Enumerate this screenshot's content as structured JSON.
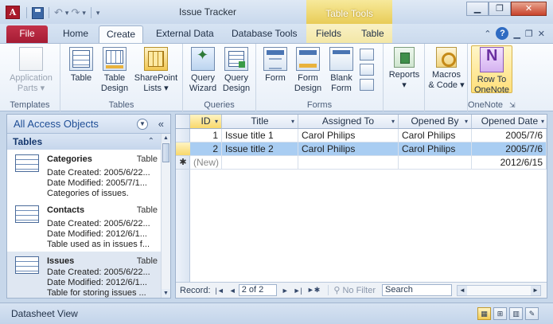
{
  "app": {
    "icon_letter": "A",
    "window_title": "Issue Tracker",
    "context_header": "Table Tools"
  },
  "qat": {
    "undo": "↶",
    "redo": "↷",
    "customize": "▾"
  },
  "window_controls": {
    "minimize": "▁",
    "restore": "❐",
    "close": "✕"
  },
  "tabs": {
    "file": "File",
    "home": "Home",
    "create": "Create",
    "external": "External Data",
    "dbtools": "Database Tools",
    "fields": "Fields",
    "table": "Table"
  },
  "ribbon_right": {
    "minimize": "⌃",
    "help": "?"
  },
  "ribbon": {
    "templates": {
      "label": "Templates",
      "app_parts_1": "Application",
      "app_parts_2": "Parts ▾"
    },
    "tables": {
      "label": "Tables",
      "table": "Table",
      "tdesign_1": "Table",
      "tdesign_2": "Design",
      "sp_1": "SharePoint",
      "sp_2": "Lists ▾"
    },
    "queries": {
      "label": "Queries",
      "wiz_1": "Query",
      "wiz_2": "Wizard",
      "qd_1": "Query",
      "qd_2": "Design"
    },
    "forms": {
      "label": "Forms",
      "form": "Form",
      "fdesign_1": "Form",
      "fdesign_2": "Design",
      "blank_1": "Blank",
      "blank_2": "Form"
    },
    "reports": {
      "label_1": "Reports",
      "label_2": "▾"
    },
    "macros": {
      "label_1": "Macros",
      "label_2": "& Code ▾"
    },
    "onenote": {
      "label": "OneNote",
      "btn_1": "Row To",
      "btn_2": "OneNote",
      "launcher": "⇲"
    }
  },
  "navpane": {
    "title": "All Access Objects",
    "picker": "▼",
    "collapse": "«",
    "category": "Tables",
    "category_chevron": "⌃",
    "items": [
      {
        "name": "Categories",
        "type": "Table",
        "created": "Date Created: 2005/6/22...",
        "modified": "Date Modified: 2005/7/1...",
        "desc": "Categories of issues."
      },
      {
        "name": "Contacts",
        "type": "Table",
        "created": "Date Created: 2005/6/22...",
        "modified": "Date Modified: 2012/6/1...",
        "desc": "Table used as in issues f..."
      },
      {
        "name": "Issues",
        "type": "Table",
        "created": "Date Created: 2005/6/22...",
        "modified": "Date Modified: 2012/6/1...",
        "desc": "Table for storing issues ..."
      }
    ],
    "scroll_up": "▲",
    "scroll_down": "▼"
  },
  "datasheet": {
    "columns": {
      "id": "ID",
      "title": "Title",
      "assigned": "Assigned To",
      "opened_by": "Opened By",
      "opened_date": "Opened Date",
      "dd": "▾"
    },
    "rows": [
      {
        "id": "1",
        "title": "Issue title 1",
        "assigned": "Carol Philips",
        "opened_by": "Carol Philips",
        "opened_date": "2005/7/6"
      },
      {
        "id": "2",
        "title": "Issue title 2",
        "assigned": "Carol Philips",
        "opened_by": "Carol Philips",
        "opened_date": "2005/7/6"
      }
    ],
    "new_row": {
      "marker": "✱",
      "id": "(New)",
      "opened_date": "2012/6/15"
    },
    "recbar": {
      "label": "Record:",
      "first": "|◄",
      "prev": "◄",
      "position": "2 of 2",
      "next": "►",
      "last": "►|",
      "new": "►✱",
      "filter": "No Filter",
      "search_placeholder": "Search",
      "hleft": "◄",
      "hright": "►"
    }
  },
  "statusbar": {
    "text": "Datasheet View",
    "v1": "▦",
    "v2": "⊞",
    "v3": "▥",
    "v4": "✎"
  }
}
